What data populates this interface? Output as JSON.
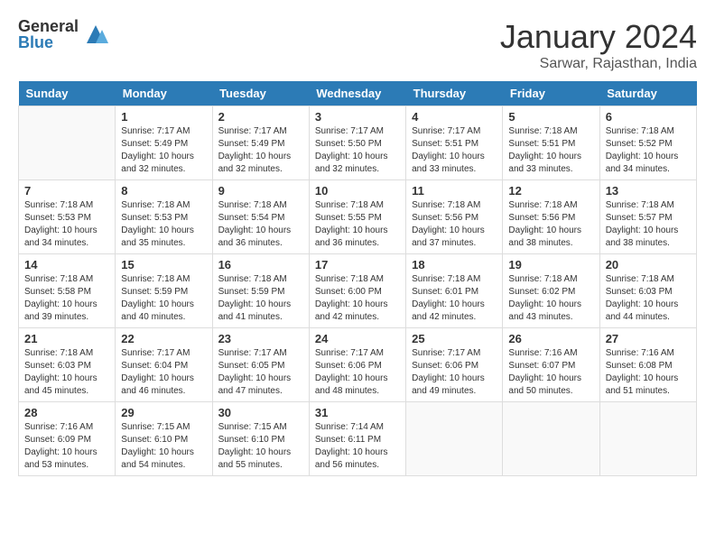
{
  "logo": {
    "general": "General",
    "blue": "Blue"
  },
  "header": {
    "month": "January 2024",
    "location": "Sarwar, Rajasthan, India"
  },
  "weekdays": [
    "Sunday",
    "Monday",
    "Tuesday",
    "Wednesday",
    "Thursday",
    "Friday",
    "Saturday"
  ],
  "weeks": [
    [
      {
        "day": "",
        "sunrise": "",
        "sunset": "",
        "daylight": ""
      },
      {
        "day": "1",
        "sunrise": "Sunrise: 7:17 AM",
        "sunset": "Sunset: 5:49 PM",
        "daylight": "Daylight: 10 hours and 32 minutes."
      },
      {
        "day": "2",
        "sunrise": "Sunrise: 7:17 AM",
        "sunset": "Sunset: 5:49 PM",
        "daylight": "Daylight: 10 hours and 32 minutes."
      },
      {
        "day": "3",
        "sunrise": "Sunrise: 7:17 AM",
        "sunset": "Sunset: 5:50 PM",
        "daylight": "Daylight: 10 hours and 32 minutes."
      },
      {
        "day": "4",
        "sunrise": "Sunrise: 7:17 AM",
        "sunset": "Sunset: 5:51 PM",
        "daylight": "Daylight: 10 hours and 33 minutes."
      },
      {
        "day": "5",
        "sunrise": "Sunrise: 7:18 AM",
        "sunset": "Sunset: 5:51 PM",
        "daylight": "Daylight: 10 hours and 33 minutes."
      },
      {
        "day": "6",
        "sunrise": "Sunrise: 7:18 AM",
        "sunset": "Sunset: 5:52 PM",
        "daylight": "Daylight: 10 hours and 34 minutes."
      }
    ],
    [
      {
        "day": "7",
        "sunrise": "Sunrise: 7:18 AM",
        "sunset": "Sunset: 5:53 PM",
        "daylight": "Daylight: 10 hours and 34 minutes."
      },
      {
        "day": "8",
        "sunrise": "Sunrise: 7:18 AM",
        "sunset": "Sunset: 5:53 PM",
        "daylight": "Daylight: 10 hours and 35 minutes."
      },
      {
        "day": "9",
        "sunrise": "Sunrise: 7:18 AM",
        "sunset": "Sunset: 5:54 PM",
        "daylight": "Daylight: 10 hours and 36 minutes."
      },
      {
        "day": "10",
        "sunrise": "Sunrise: 7:18 AM",
        "sunset": "Sunset: 5:55 PM",
        "daylight": "Daylight: 10 hours and 36 minutes."
      },
      {
        "day": "11",
        "sunrise": "Sunrise: 7:18 AM",
        "sunset": "Sunset: 5:56 PM",
        "daylight": "Daylight: 10 hours and 37 minutes."
      },
      {
        "day": "12",
        "sunrise": "Sunrise: 7:18 AM",
        "sunset": "Sunset: 5:56 PM",
        "daylight": "Daylight: 10 hours and 38 minutes."
      },
      {
        "day": "13",
        "sunrise": "Sunrise: 7:18 AM",
        "sunset": "Sunset: 5:57 PM",
        "daylight": "Daylight: 10 hours and 38 minutes."
      }
    ],
    [
      {
        "day": "14",
        "sunrise": "Sunrise: 7:18 AM",
        "sunset": "Sunset: 5:58 PM",
        "daylight": "Daylight: 10 hours and 39 minutes."
      },
      {
        "day": "15",
        "sunrise": "Sunrise: 7:18 AM",
        "sunset": "Sunset: 5:59 PM",
        "daylight": "Daylight: 10 hours and 40 minutes."
      },
      {
        "day": "16",
        "sunrise": "Sunrise: 7:18 AM",
        "sunset": "Sunset: 5:59 PM",
        "daylight": "Daylight: 10 hours and 41 minutes."
      },
      {
        "day": "17",
        "sunrise": "Sunrise: 7:18 AM",
        "sunset": "Sunset: 6:00 PM",
        "daylight": "Daylight: 10 hours and 42 minutes."
      },
      {
        "day": "18",
        "sunrise": "Sunrise: 7:18 AM",
        "sunset": "Sunset: 6:01 PM",
        "daylight": "Daylight: 10 hours and 42 minutes."
      },
      {
        "day": "19",
        "sunrise": "Sunrise: 7:18 AM",
        "sunset": "Sunset: 6:02 PM",
        "daylight": "Daylight: 10 hours and 43 minutes."
      },
      {
        "day": "20",
        "sunrise": "Sunrise: 7:18 AM",
        "sunset": "Sunset: 6:03 PM",
        "daylight": "Daylight: 10 hours and 44 minutes."
      }
    ],
    [
      {
        "day": "21",
        "sunrise": "Sunrise: 7:18 AM",
        "sunset": "Sunset: 6:03 PM",
        "daylight": "Daylight: 10 hours and 45 minutes."
      },
      {
        "day": "22",
        "sunrise": "Sunrise: 7:17 AM",
        "sunset": "Sunset: 6:04 PM",
        "daylight": "Daylight: 10 hours and 46 minutes."
      },
      {
        "day": "23",
        "sunrise": "Sunrise: 7:17 AM",
        "sunset": "Sunset: 6:05 PM",
        "daylight": "Daylight: 10 hours and 47 minutes."
      },
      {
        "day": "24",
        "sunrise": "Sunrise: 7:17 AM",
        "sunset": "Sunset: 6:06 PM",
        "daylight": "Daylight: 10 hours and 48 minutes."
      },
      {
        "day": "25",
        "sunrise": "Sunrise: 7:17 AM",
        "sunset": "Sunset: 6:06 PM",
        "daylight": "Daylight: 10 hours and 49 minutes."
      },
      {
        "day": "26",
        "sunrise": "Sunrise: 7:16 AM",
        "sunset": "Sunset: 6:07 PM",
        "daylight": "Daylight: 10 hours and 50 minutes."
      },
      {
        "day": "27",
        "sunrise": "Sunrise: 7:16 AM",
        "sunset": "Sunset: 6:08 PM",
        "daylight": "Daylight: 10 hours and 51 minutes."
      }
    ],
    [
      {
        "day": "28",
        "sunrise": "Sunrise: 7:16 AM",
        "sunset": "Sunset: 6:09 PM",
        "daylight": "Daylight: 10 hours and 53 minutes."
      },
      {
        "day": "29",
        "sunrise": "Sunrise: 7:15 AM",
        "sunset": "Sunset: 6:10 PM",
        "daylight": "Daylight: 10 hours and 54 minutes."
      },
      {
        "day": "30",
        "sunrise": "Sunrise: 7:15 AM",
        "sunset": "Sunset: 6:10 PM",
        "daylight": "Daylight: 10 hours and 55 minutes."
      },
      {
        "day": "31",
        "sunrise": "Sunrise: 7:14 AM",
        "sunset": "Sunset: 6:11 PM",
        "daylight": "Daylight: 10 hours and 56 minutes."
      },
      {
        "day": "",
        "sunrise": "",
        "sunset": "",
        "daylight": ""
      },
      {
        "day": "",
        "sunrise": "",
        "sunset": "",
        "daylight": ""
      },
      {
        "day": "",
        "sunrise": "",
        "sunset": "",
        "daylight": ""
      }
    ]
  ]
}
